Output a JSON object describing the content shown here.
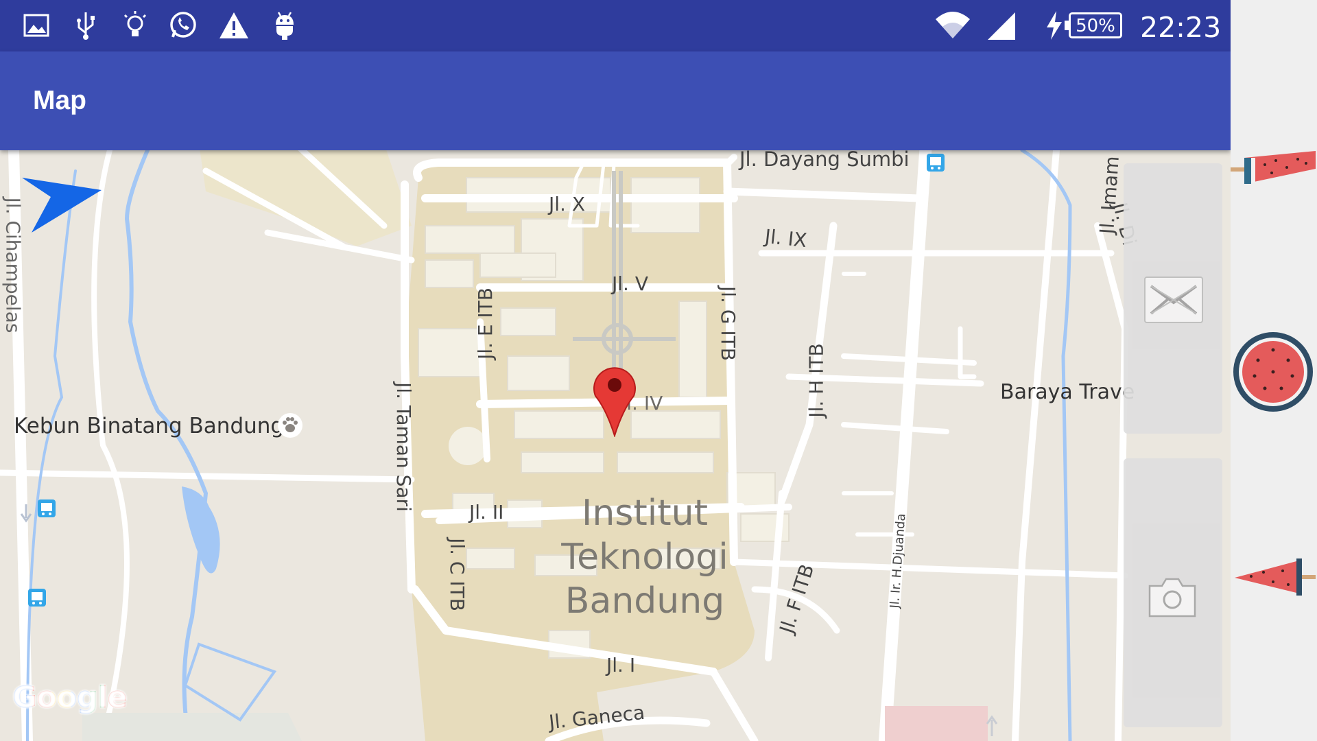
{
  "status_bar": {
    "time": "22:23",
    "battery": "50%",
    "left_icons": [
      "gallery-icon",
      "usb-icon",
      "lightbulb-icon",
      "whatsapp-icon",
      "warning-icon",
      "android-icon"
    ],
    "right_icons": [
      "wifi-icon",
      "signal-icon",
      "charging-icon",
      "battery-icon"
    ]
  },
  "app_bar": {
    "title": "Map"
  },
  "map": {
    "roads": {
      "dayang_sumbi": "Jl. Dayang Sumbi",
      "x": "Jl. X",
      "ix": "Jl. IX",
      "v": "Jl. V",
      "iv": "Jl. IV",
      "e_itb": "Jl. E ITB",
      "g_itb": "Jl. G ITB",
      "h_itb": "Jl. H ITB",
      "taman_sari": "Jl. Taman Sari",
      "cihampelas": "Jl. Cihampelas",
      "ii": "Jl. II",
      "c_itb": "Jl. C ITB",
      "i": "Jl. I",
      "f_itb": "Jl. F ITB",
      "ganeca": "Jl. Ganeca",
      "ir_h_djuanda": "Jl. Ir. H.Djuanda",
      "imam_bonjol": "Jl. Imam Bonjol",
      "dipati": "Jl. Di"
    },
    "places": {
      "kebun_binatang": "Kebun Binatang Bandung",
      "baraya": "Baraya Trave"
    },
    "campus": [
      "Institut",
      "Teknologi",
      "Bandung"
    ],
    "logo": "Google"
  },
  "controls": {
    "nav_arrow": "navigation-arrow-icon",
    "panel_top_button": "envelope-icon",
    "panel_bottom_button": "camera-icon"
  },
  "colors": {
    "status_bar": "#2f3c9d",
    "app_bar": "#3d4fb4",
    "map_ground": "#ebe7df",
    "campus": "#e7dcbc",
    "water": "#a3c7f5",
    "marker": "#e53935"
  }
}
